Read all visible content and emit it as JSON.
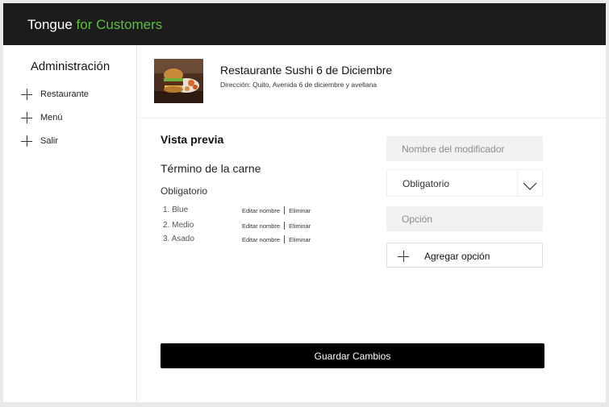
{
  "header": {
    "brand_primary": "Tongue",
    "brand_accent": "for Customers",
    "accent_color": "#5cbe3c",
    "background_color": "#1c1c1c"
  },
  "sidebar": {
    "title": "Administración",
    "items": [
      {
        "label": "Restaurante",
        "icon": "plus-icon"
      },
      {
        "label": "Menú",
        "icon": "plus-icon"
      },
      {
        "label": "Salir",
        "icon": "plus-icon"
      }
    ]
  },
  "restaurant": {
    "name": "Restaurante Sushi 6 de Diciembre",
    "address": "Dirección: Quito, Avenida 6 de diciembre y avellana",
    "image": "burger-photo"
  },
  "preview": {
    "title": "Vista previa",
    "group_name": "Término de la carne",
    "requirement": "Obligatorio",
    "options": [
      {
        "name": "1. Blue",
        "edit_label": "Editar nombre",
        "delete_label": "Eliminar"
      },
      {
        "name": "2. Medio",
        "edit_label": "Editar nombre",
        "delete_label": "Eliminar"
      },
      {
        "name": "3. Asado",
        "edit_label": "Editar nombre",
        "delete_label": "Eliminar"
      }
    ]
  },
  "form": {
    "modifier_name_placeholder": "Nombre del modificador",
    "requirement_select": "Obligatorio",
    "option_placeholder": "Opción",
    "add_option_label": "Agregar opción"
  },
  "actions": {
    "save_label": "Guardar Cambios"
  }
}
